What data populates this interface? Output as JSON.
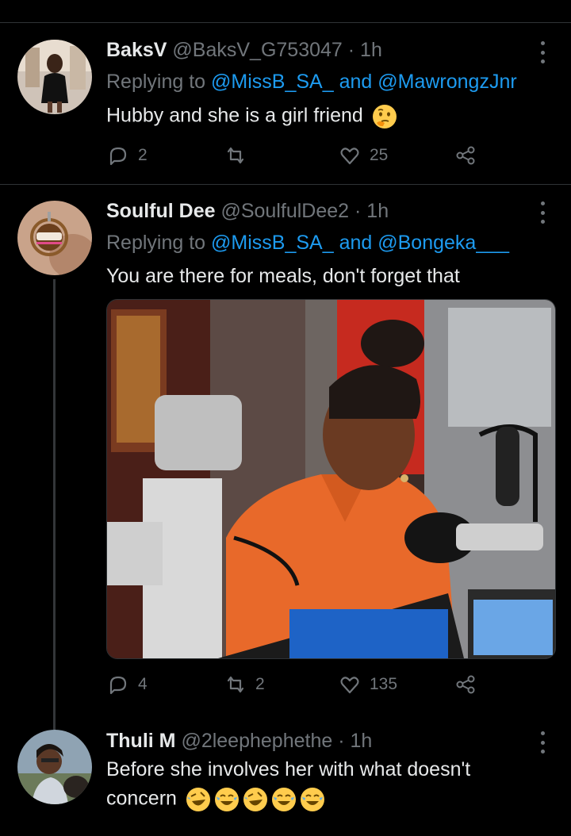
{
  "tweets": [
    {
      "name": "BaksV",
      "handle": "@BaksV_G753047",
      "dot": "·",
      "time": "1h",
      "replying_prefix": "Replying to",
      "mention1": "@MissB_SA_",
      "and": "and",
      "mention2": "@MawrongzJnr",
      "text": "Hubby and she is a girl friend",
      "emoji": "thinking-face",
      "reply_count": "2",
      "retweet_count": "",
      "like_count": "25"
    },
    {
      "name": "Soulful Dee",
      "handle": "@SoulfulDee2",
      "dot": "·",
      "time": "1h",
      "replying_prefix": "Replying to",
      "mention1": "@MissB_SA_",
      "and": "and",
      "mention2": "@Bongeka___",
      "text": "You are there for meals, don't forget that",
      "reply_count": "4",
      "retweet_count": "2",
      "like_count": "135"
    },
    {
      "name": "Thuli M",
      "handle": "@2leephephethe",
      "dot": "·",
      "time": "1h",
      "text_line1": "Before she involves her with what doesn't",
      "text_line2": "concern",
      "emojis": [
        "rolling-on-floor-laughing",
        "tears-of-joy",
        "rolling-on-floor-laughing",
        "tears-of-joy",
        "tears-of-joy"
      ]
    }
  ],
  "colors": {
    "background": "#000000",
    "text": "#e7e9ea",
    "muted": "#71767b",
    "link": "#1d9bf0",
    "divider": "#2f3336"
  }
}
